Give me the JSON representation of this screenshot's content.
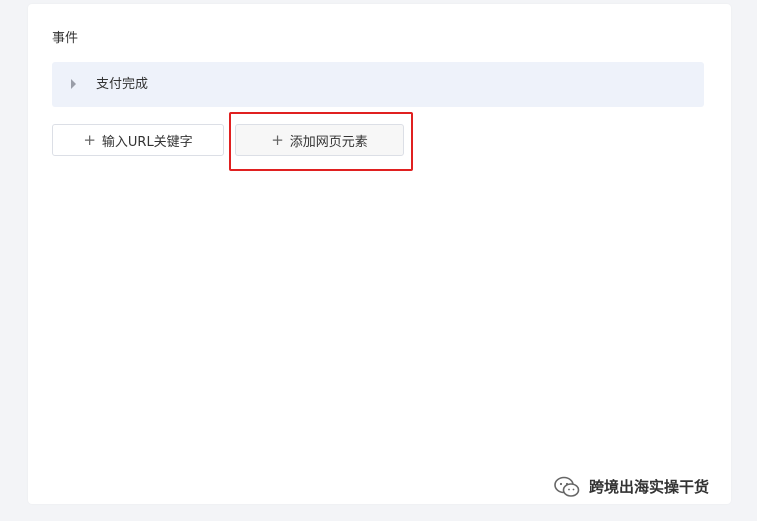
{
  "section": {
    "title": "事件"
  },
  "event": {
    "label": "支付完成"
  },
  "buttons": {
    "add_url_keyword": "输入URL关键字",
    "add_page_element": "添加网页元素",
    "plus": "+"
  },
  "watermark": {
    "text": "跨境出海实操干货",
    "icon": "wechat-icon"
  },
  "colors": {
    "highlight": "#e02020",
    "event_row_bg": "#eef2fa"
  }
}
